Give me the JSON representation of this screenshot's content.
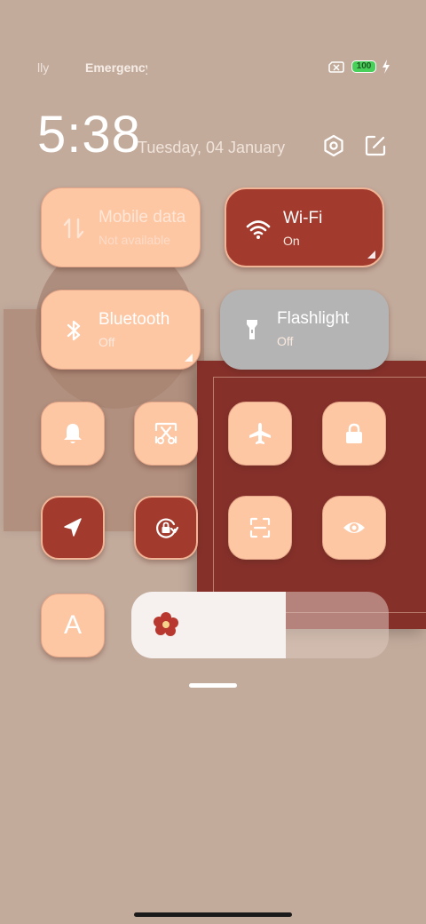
{
  "status_bar": {
    "carrier1": "lly",
    "carrier2": "Emergency",
    "battery_level": "100",
    "battery_color": "#49d05a"
  },
  "header": {
    "time": "5:38",
    "date": "Tuesday, 04 January",
    "settings_icon": "hexagon-settings-icon",
    "edit_icon": "edit-icon"
  },
  "tiles": {
    "mobile_data": {
      "title": "Mobile data",
      "subtitle": "Not available",
      "state": "unavailable"
    },
    "wifi": {
      "title": "Wi-Fi",
      "subtitle": "On",
      "state": "on"
    },
    "bluetooth": {
      "title": "Bluetooth",
      "subtitle": "Off",
      "state": "off"
    },
    "flashlight": {
      "title": "Flashlight",
      "subtitle": "Off",
      "state": "off"
    }
  },
  "toggles": [
    {
      "icon": "bell-icon",
      "active": false
    },
    {
      "icon": "screenshot-scissors-icon",
      "active": false
    },
    {
      "icon": "airplane-icon",
      "active": false
    },
    {
      "icon": "lock-icon",
      "active": false
    },
    {
      "icon": "location-icon",
      "active": true
    },
    {
      "icon": "rotation-lock-icon",
      "active": true
    },
    {
      "icon": "scan-icon",
      "active": false
    },
    {
      "icon": "eye-icon",
      "active": false
    },
    {
      "icon": "font-icon",
      "active": false,
      "label": "A"
    }
  ],
  "brightness": {
    "level_fraction": 0.6
  },
  "colors": {
    "background": "#c3ab9c",
    "tile_active": "#a23a2e",
    "tile_inactive": "#fec7a4",
    "tile_disabled": "#b4b4b4",
    "text": "#ffffff"
  }
}
